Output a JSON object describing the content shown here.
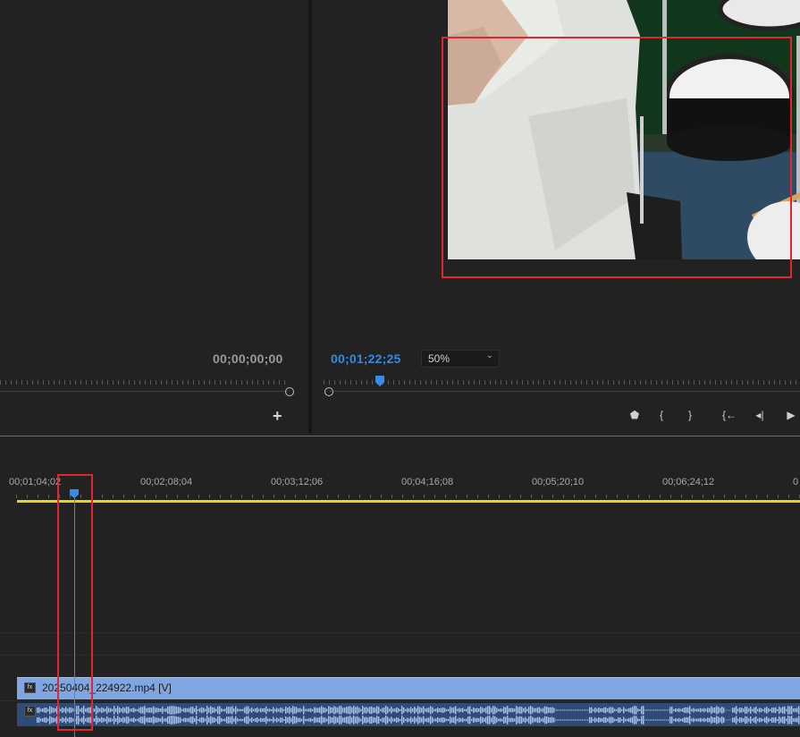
{
  "source_monitor": {
    "timecode": "00;00;00;00",
    "add_icon": "plus-icon"
  },
  "program_monitor": {
    "timecode": "00;01;22;25",
    "zoom": {
      "selected": "50%"
    },
    "transport": [
      {
        "name": "add-marker-button",
        "icon": "marker-icon",
        "glyph": "⬟"
      },
      {
        "name": "mark-in-button",
        "icon": "mark-in-icon",
        "glyph": "{"
      },
      {
        "name": "mark-out-button",
        "icon": "mark-out-icon",
        "glyph": "}"
      },
      {
        "name": "go-to-in-button",
        "icon": "go-to-in-icon",
        "glyph": "{←"
      },
      {
        "name": "step-back-button",
        "icon": "step-back-icon",
        "glyph": "◂|"
      },
      {
        "name": "play-button",
        "icon": "play-icon",
        "glyph": "▶"
      }
    ]
  },
  "timeline": {
    "ruler_labels": [
      "00;01;04;02",
      "00;02;08;04",
      "00;03;12;06",
      "00;04;16;08",
      "00;05;20;10",
      "00;06;24;12",
      "0"
    ],
    "video_clip": {
      "label": "20250404_224922.mp4 [V]",
      "fx": "fx"
    },
    "audio_clip": {
      "fx": "fx"
    }
  },
  "colors": {
    "playhead": "#3a8be6",
    "work_area": "#e8d220",
    "highlight": "#e0262e",
    "video_clip": "#7fa6e0",
    "audio_clip": "#2f4c77"
  }
}
